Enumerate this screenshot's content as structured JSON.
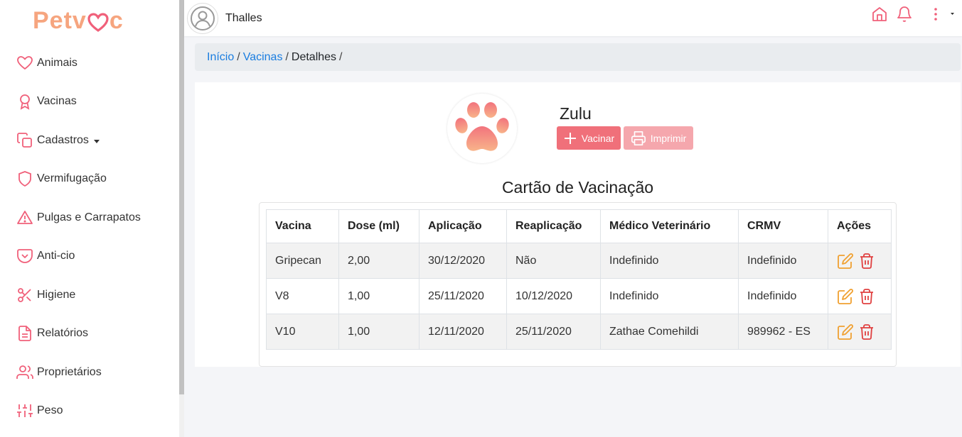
{
  "brand": {
    "logo_text_left": "Petv",
    "logo_text_right": "c"
  },
  "sidebar": {
    "items": [
      {
        "label": "Animais",
        "icon": "heart-icon"
      },
      {
        "label": "Vacinas",
        "icon": "award-icon"
      },
      {
        "label": "Cadastros",
        "icon": "copy-icon"
      },
      {
        "label": "Vermifugação",
        "icon": "shield-icon"
      },
      {
        "label": "Pulgas e Carrapatos",
        "icon": "warning-icon"
      },
      {
        "label": "Anti-cio",
        "icon": "pocket-icon"
      },
      {
        "label": "Higiene",
        "icon": "scissors-icon"
      },
      {
        "label": "Relatórios",
        "icon": "file-text-icon"
      },
      {
        "label": "Proprietários",
        "icon": "users-icon"
      },
      {
        "label": "Peso",
        "icon": "sliders-icon"
      }
    ]
  },
  "header": {
    "username": "Thalles"
  },
  "breadcrumb": {
    "home": "Início",
    "vacinas": "Vacinas",
    "current": "Detalhes",
    "sep": "/"
  },
  "pet": {
    "name": "Zulu"
  },
  "actions": {
    "vacinar": "Vacinar",
    "imprimir": "Imprimir"
  },
  "card": {
    "title": "Cartão de Vacinação"
  },
  "table": {
    "headers": [
      "Vacina",
      "Dose (ml)",
      "Aplicação",
      "Reaplicação",
      "Médico Veterinário",
      "CRMV",
      "Ações"
    ],
    "rows": [
      [
        "Gripecan",
        "2,00",
        "30/12/2020",
        "Não",
        "Indefinido",
        "Indefinido"
      ],
      [
        "V8",
        "1,00",
        "25/11/2020",
        "10/12/2020",
        "Indefinido",
        "Indefinido"
      ],
      [
        "V10",
        "1,00",
        "12/11/2020",
        "25/11/2020",
        "Zathae Comehildi",
        "989962 - ES"
      ]
    ]
  },
  "colors": {
    "accent": "#f0707a",
    "accent_light": "#f5a7ad",
    "logo": "#f6a57f",
    "link": "#1a7de0",
    "edit": "#f0a030",
    "delete": "#e04040"
  }
}
